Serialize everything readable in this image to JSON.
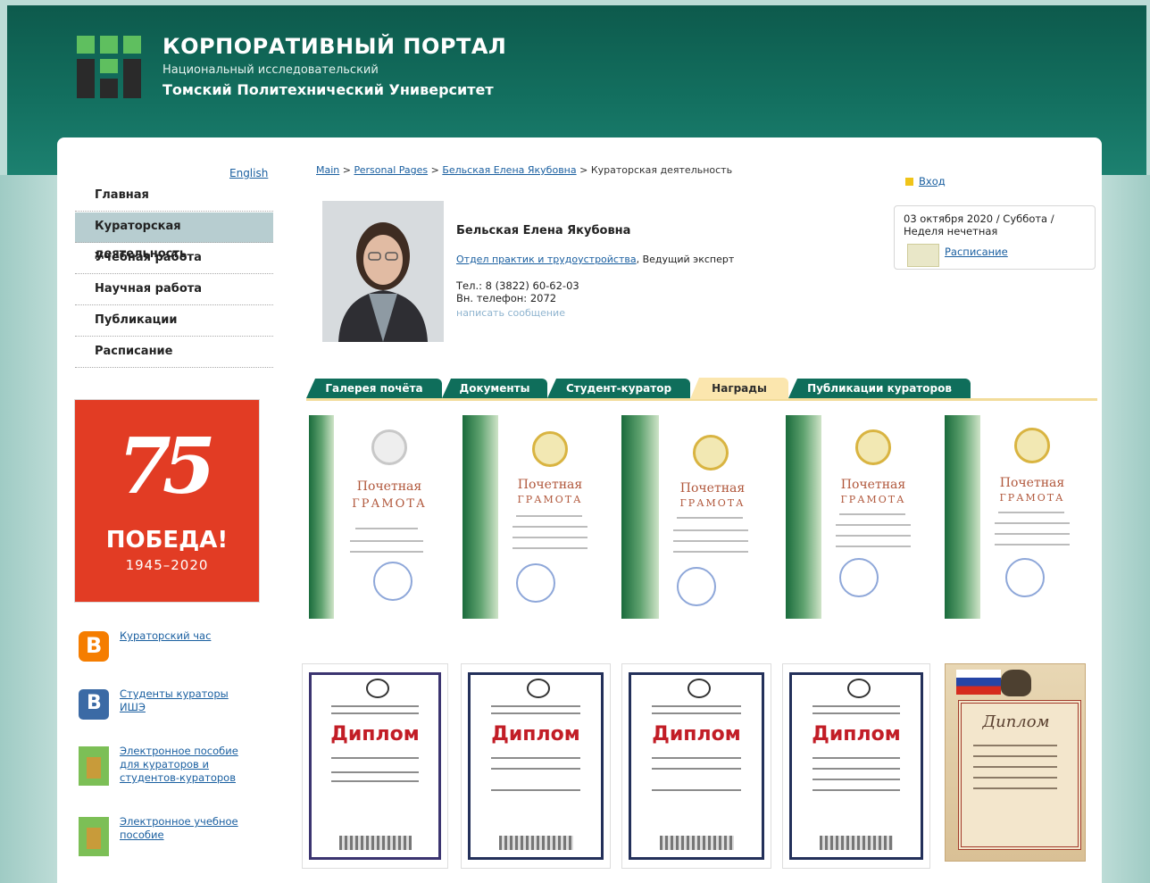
{
  "header": {
    "title": "КОРПОРАТИВНЫЙ ПОРТАЛ",
    "sub1": "Национальный исследовательский",
    "sub2": "Томский Политехнический Университет"
  },
  "lang_link": "English",
  "nav": {
    "items": [
      {
        "label": "Главная"
      },
      {
        "label": "Кураторская деятельность"
      },
      {
        "label": "Учебная работа"
      },
      {
        "label": "Научная работа"
      },
      {
        "label": "Публикации"
      },
      {
        "label": "Расписание"
      }
    ]
  },
  "banner": {
    "number": "75",
    "title": "ПОБЕДА!",
    "years": "1945–2020"
  },
  "side_links": [
    {
      "label": "Кураторский час",
      "icon": "blogger-icon"
    },
    {
      "label": "Студенты кураторы ИШЭ",
      "icon": "vk-icon"
    },
    {
      "label": "Электронное пособие для кураторов и студентов-кураторов",
      "icon": "book-icon"
    },
    {
      "label": "Электронное учебное пособие",
      "icon": "book-icon"
    }
  ],
  "breadcrumb": {
    "links": [
      "Main",
      "Personal Pages",
      "Бельская Елена Якубовна"
    ],
    "sep": ">",
    "current": "Кураторская деятельность"
  },
  "login": {
    "label": "Вход"
  },
  "datebox": {
    "date": "03 октября 2020 / Суббота /",
    "week": "Неделя нечетная",
    "schedule": "Расписание"
  },
  "profile": {
    "name": "Бельская Елена Якубовна",
    "dept": "Отдел практик и трудоустройства",
    "position": ", Ведущий эксперт",
    "tel": "Тел.: 8 (3822) 60-62-03",
    "ext": "Вн. телефон: 2072",
    "message": "написать сообщение"
  },
  "tabs": [
    {
      "label": "Галерея почёта"
    },
    {
      "label": "Документы"
    },
    {
      "label": "Студент-куратор"
    },
    {
      "label": "Награды",
      "active": true
    },
    {
      "label": "Публикации кураторов"
    }
  ],
  "gallery": {
    "row1": [
      {
        "title": "Почетная",
        "sub": "ГРАМОТА"
      },
      {
        "title": "Почетная",
        "sub": "ГРАМОТА"
      },
      {
        "title": "Почетная",
        "sub": "ГРАМОТА"
      },
      {
        "title": "Почетная",
        "sub": "ГРАМОТА"
      },
      {
        "title": "Почетная",
        "sub": "ГРАМОТА"
      }
    ],
    "row2": [
      {
        "title": "Диплом"
      },
      {
        "title": "Диплом"
      },
      {
        "title": "Диплом"
      },
      {
        "title": "Диплом"
      },
      {
        "title": "Диплом"
      }
    ]
  },
  "colors": {
    "header": "#0f6e5b",
    "tab": "#0f6e5b",
    "tab_active": "#fbe6ae",
    "nav_active": "#b7cdd0",
    "link": "#1a5fa0",
    "banner": "#e23c24",
    "diploma_red": "#c21d26"
  }
}
